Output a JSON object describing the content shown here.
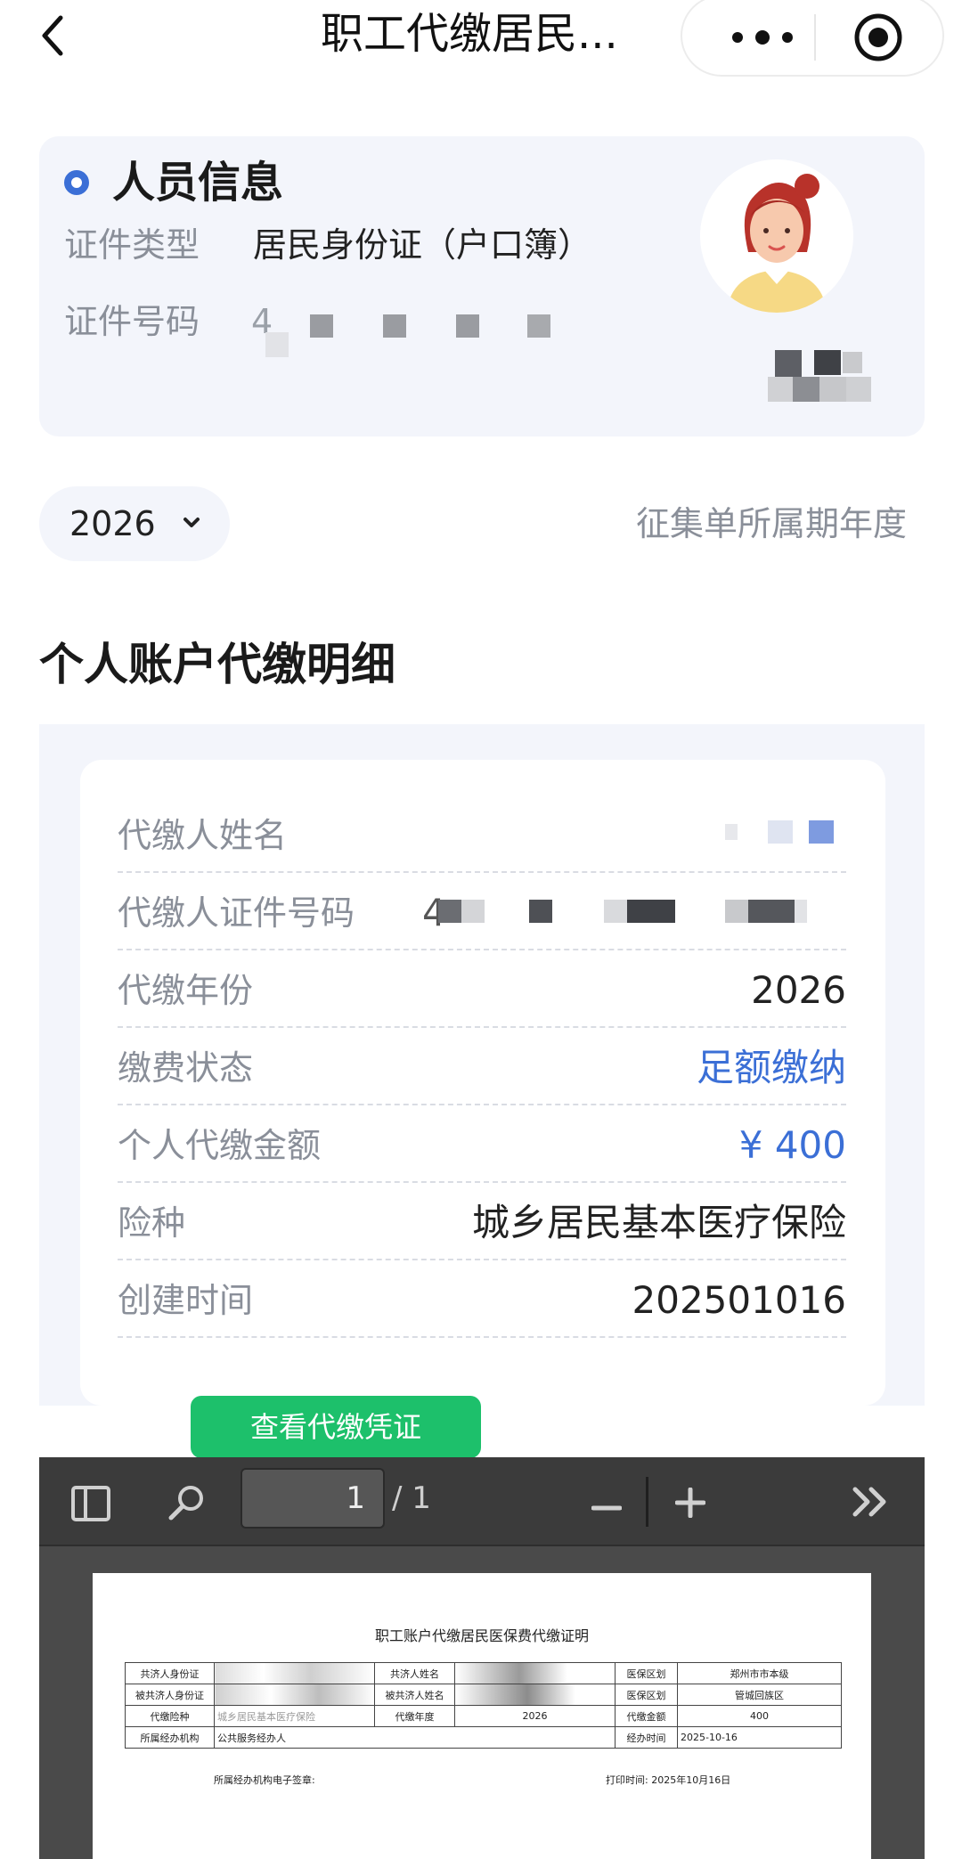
{
  "nav": {
    "title": "职工代缴居民..."
  },
  "person_info": {
    "title": "人员信息",
    "id_type_label": "证件类型",
    "id_type_value": "居民身份证（户口簿）",
    "id_number_label": "证件号码",
    "id_number_prefix": "4"
  },
  "year_selector": {
    "value": "2026",
    "hint": "征集单所属期年度"
  },
  "section": {
    "title": "个人账户代缴明细"
  },
  "details": {
    "payer_name_label": "代缴人姓名",
    "payer_id_label": "代缴人证件号码",
    "payer_id_prefix": "4",
    "year_label": "代缴年份",
    "year_value": "2026",
    "status_label": "缴费状态",
    "status_value": "足额缴纳",
    "amount_label": "个人代缴金额",
    "amount_value": "¥ 400",
    "insurance_label": "险种",
    "insurance_value": "城乡居民基本医疗保险",
    "created_label": "创建时间",
    "created_value": "202501016"
  },
  "voucher_button": "查看代缴凭证",
  "pdf_viewer": {
    "page_current": "1",
    "page_total": "/ 1",
    "document": {
      "title": "职工账户代缴居民医保费代缴证明",
      "r1_c1": "共济人身份证",
      "r1_c3": "共济人姓名",
      "r1_c5": "医保区划",
      "r1_c6": "郑州市市本级",
      "r2_c1": "被共济人身份证",
      "r2_c3": "被共济人姓名",
      "r2_c5": "医保区划",
      "r2_c6": "管城回族区",
      "r3_c1": "代缴险种",
      "r3_c2": "城乡居民基本医疗保险",
      "r3_c3": "代缴年度",
      "r3_c4": "2026",
      "r3_c5": "代缴金额",
      "r3_c6": "400",
      "r4_c1": "所属经办机构",
      "r4_c2": "公共服务经办人",
      "r4_c5": "经办时间",
      "r4_c6": "2025-10-16",
      "signature_label": "所属经办机构电子签章:",
      "print_time": "打印时间: 2025年10月16日"
    }
  },
  "colors": {
    "accent_blue": "#3b6fd6",
    "button_green": "#1dc06b",
    "card_bg": "#f3f5fb",
    "label_gray": "#8a8f99"
  },
  "icons": [
    "back-chevron-icon",
    "more-dots-icon",
    "target-icon",
    "chevron-down-icon",
    "sidebar-toggle-icon",
    "search-icon",
    "zoom-out-icon",
    "zoom-in-icon",
    "double-chevron-right-icon"
  ]
}
